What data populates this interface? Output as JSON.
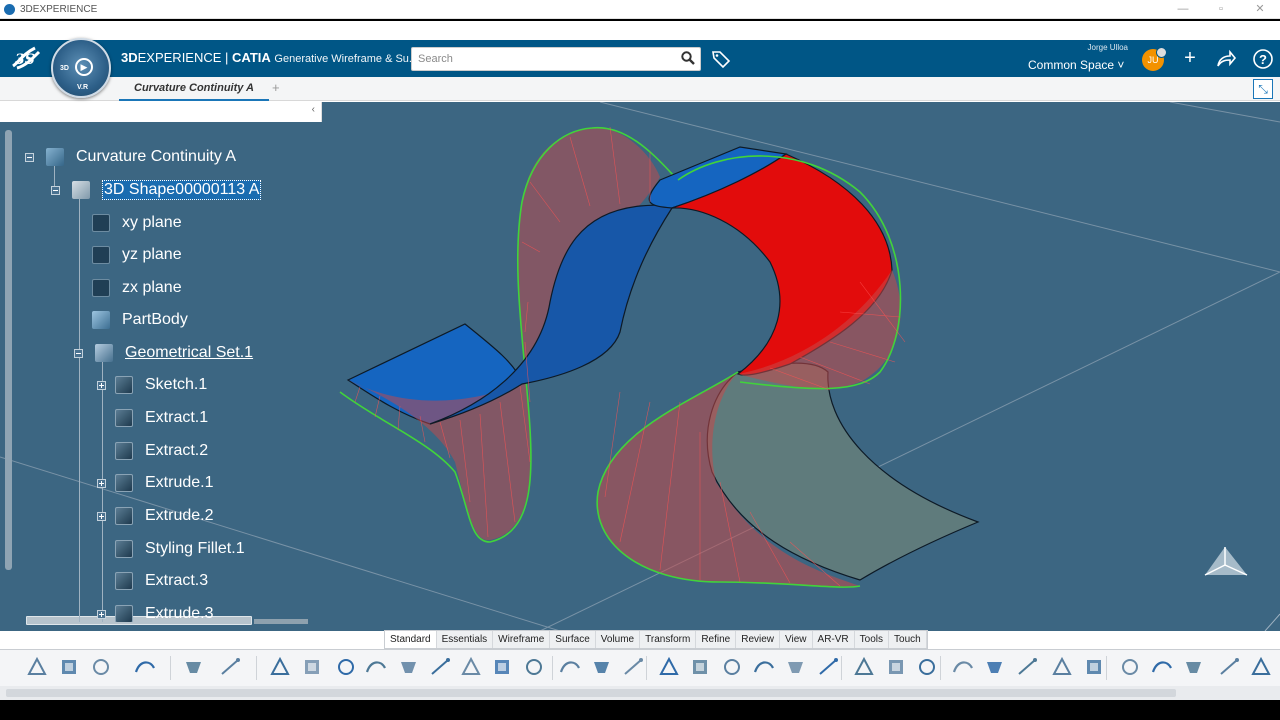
{
  "window": {
    "title": "3DEXPERIENCE"
  },
  "header": {
    "brand_bold": "3D",
    "brand_rest": "EXPERIENCE | ",
    "brand_app": "CATIA",
    "app_name": "Generative Wireframe & Su...",
    "compass_label_3d": "3D",
    "compass_label_vr": "V.R",
    "search_placeholder": "Search",
    "user_name": "Jorge Ulloa",
    "space": "Common Space ˅",
    "avatar_initials": "JU",
    "colors": {
      "bar": "#005686",
      "avatar": "#f39200"
    }
  },
  "tabs": {
    "active": "Curvature Continuity A",
    "add": "+"
  },
  "tree": {
    "root": "Curvature Continuity A",
    "shape": "3D Shape00000113 A",
    "items": [
      {
        "label": "xy plane",
        "icon": "plane-icon"
      },
      {
        "label": "yz plane",
        "icon": "plane-icon"
      },
      {
        "label": "zx plane",
        "icon": "plane-icon"
      },
      {
        "label": "PartBody",
        "icon": "body-icon"
      },
      {
        "label": "Geometrical Set.1",
        "icon": "geometrical-set-icon"
      },
      {
        "label": "Sketch.1",
        "icon": "sketch-icon"
      },
      {
        "label": "Extract.1",
        "icon": "extract-icon"
      },
      {
        "label": "Extract.2",
        "icon": "extract-icon"
      },
      {
        "label": "Extrude.1",
        "icon": "extrude-icon"
      },
      {
        "label": "Extrude.2",
        "icon": "extrude-icon"
      },
      {
        "label": "Styling Fillet.1",
        "icon": "fillet-icon"
      },
      {
        "label": "Extract.3",
        "icon": "extract-icon"
      },
      {
        "label": "Extrude.3",
        "icon": "extrude-icon"
      }
    ]
  },
  "section_tabs": [
    "Standard",
    "Essentials",
    "Wireframe",
    "Surface",
    "Volume",
    "Transform",
    "Refine",
    "Review",
    "View",
    "AR-VR",
    "Tools",
    "Touch"
  ],
  "toolbar_icons": [
    "cut-icon",
    "copy-icon",
    "paste-icon",
    "undo-icon",
    "zoom-icon",
    "update-icon",
    "sketch-icon",
    "sketch-edit-icon",
    "point-icon",
    "line-icon",
    "axis-icon",
    "plane-icon",
    "axis-system-icon",
    "circle-icon",
    "spline-icon",
    "sweep-icon",
    "multi-section-icon",
    "blend-icon",
    "extrude-icon",
    "revolve-icon",
    "fill-icon",
    "offset-icon",
    "join-icon",
    "heal-icon",
    "split-icon",
    "trim-icon",
    "fillet-icon",
    "pattern-icon",
    "translate-icon",
    "transform-icon",
    "extrapolate-icon",
    "measure-icon",
    "connect-icon",
    "analysis-icon",
    "curvature-icon",
    "porcupine-icon",
    "display-icon",
    "shading-icon"
  ],
  "viewport": {
    "background": "#3c6682",
    "surface_blue": "#1565c0",
    "surface_red": "#e20c0c",
    "surface_gray": "#5f7b7c",
    "boundary": "#41d33b",
    "comb": "#ff3a3a"
  }
}
